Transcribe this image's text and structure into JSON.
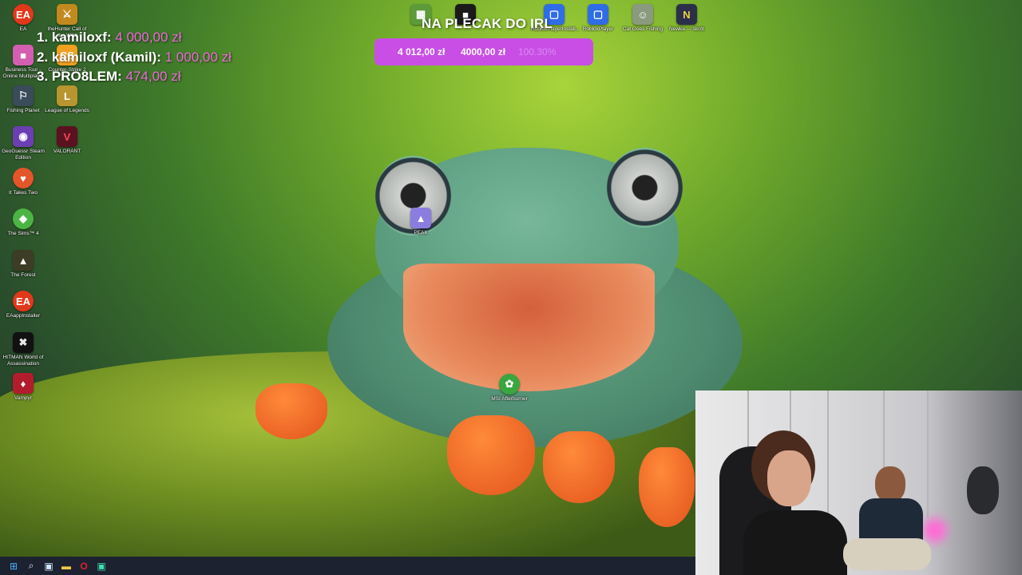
{
  "desktop_icons": [
    {
      "label": "EA",
      "glyph": "EA",
      "color": "#e2381a"
    },
    {
      "label": "theHunter Call of the Wild",
      "glyph": "⚔",
      "color": "#c28a1e"
    },
    {
      "label": "Business Tour - Online Multiplay...",
      "glyph": "■",
      "color": "#d45fb0"
    },
    {
      "label": "Counter-Strike 2",
      "glyph": "CS",
      "color": "#f0a020"
    },
    {
      "label": "Fishing Planet",
      "glyph": "⚐",
      "color": "#3a4b5a"
    },
    {
      "label": "League of Legends",
      "glyph": "L",
      "color": "#b8952e"
    },
    {
      "label": "GeoGuessr Steam Edition",
      "glyph": "◉",
      "color": "#6b3fb2"
    },
    {
      "label": "VALORANT",
      "glyph": "V",
      "color": "#5a1220"
    },
    {
      "label": "It Takes Two",
      "glyph": "♥",
      "color": "#e4552a"
    },
    {
      "label": "The Sims™ 4",
      "glyph": "◆",
      "color": "#4bb543"
    },
    {
      "label": "The Forest",
      "glyph": "▲",
      "color": "#3d3d26"
    },
    {
      "label": "EAappInstaller",
      "glyph": "EA",
      "color": "#e2381a"
    },
    {
      "label": "HITMAN World of Assassination",
      "glyph": "✖",
      "color": "#e6e6e6"
    },
    {
      "label": "Vampyr",
      "glyph": "♦",
      "color": "#b31c2c"
    },
    {
      "label": "PEAK",
      "glyph": "▲",
      "color": "#8b7de0"
    },
    {
      "label": "MSI Afterburner",
      "glyph": "✿",
      "color": "#3aa640"
    }
  ],
  "top_icons": [
    {
      "label": "Minecraft",
      "glyph": "▦",
      "color": "#5d9a3a"
    },
    {
      "label": "Roblox",
      "glyph": "■",
      "color": "#1a1a1a"
    },
    {
      "label": "RobloxPlayerInstall...",
      "glyph": "▢",
      "color": "#2f6ce8"
    },
    {
      "label": "RobloxPlayer",
      "glyph": "▢",
      "color": "#2f6ce8"
    },
    {
      "label": "Cat Goes Fishing",
      "glyph": "☺",
      "color": "#8a9a7e"
    },
    {
      "label": "Newka — skrót",
      "glyph": "N",
      "color": "#2b2f4a"
    }
  ],
  "donors": [
    {
      "name": "1. kamiloxf:",
      "amount": "4 000,00 zł"
    },
    {
      "name": "2. kamiloxf (Kamil):",
      "amount": "1 000,00 zł"
    },
    {
      "name": "3. PRO8LEM:",
      "amount": "474,00 zł"
    }
  ],
  "goal": {
    "title": "NA PLECAK DO IRL",
    "current": "4 012,00 zł",
    "target": "4000,00 zł",
    "percent": "100.30%",
    "bar_color": "#c84ee6"
  },
  "taskbar": {
    "start": "⊞",
    "search": "⌕",
    "taskview": "▣",
    "explorer": "▬",
    "opera": "O",
    "app": "▣"
  }
}
